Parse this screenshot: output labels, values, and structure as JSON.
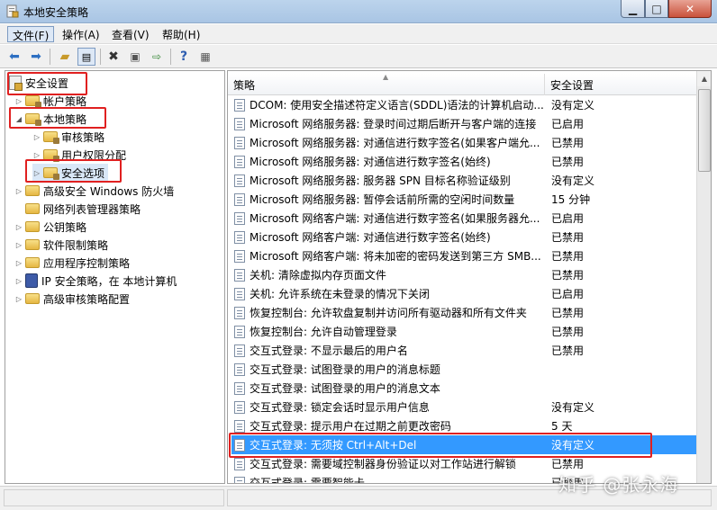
{
  "window": {
    "title": "本地安全策略"
  },
  "menu": {
    "items": [
      "文件(F)",
      "操作(A)",
      "查看(V)",
      "帮助(H)"
    ]
  },
  "tree": {
    "root": "安全设置",
    "items": [
      {
        "label": "帐户策略"
      },
      {
        "label": "本地策略"
      },
      {
        "label": "审核策略"
      },
      {
        "label": "用户权限分配"
      },
      {
        "label": "安全选项"
      },
      {
        "label": "高级安全 Windows 防火墙"
      },
      {
        "label": "网络列表管理器策略"
      },
      {
        "label": "公钥策略"
      },
      {
        "label": "软件限制策略"
      },
      {
        "label": "应用程序控制策略"
      },
      {
        "label": "IP 安全策略，在 本地计算机"
      },
      {
        "label": "高级审核策略配置"
      }
    ]
  },
  "list": {
    "columns": [
      "策略",
      "安全设置"
    ],
    "rows": [
      {
        "name": "DCOM: 使用安全描述符定义语言(SDDL)语法的计算机启动...",
        "value": "没有定义"
      },
      {
        "name": "Microsoft 网络服务器: 登录时间过期后断开与客户端的连接",
        "value": "已启用"
      },
      {
        "name": "Microsoft 网络服务器: 对通信进行数字签名(如果客户端允...",
        "value": "已禁用"
      },
      {
        "name": "Microsoft 网络服务器: 对通信进行数字签名(始终)",
        "value": "已禁用"
      },
      {
        "name": "Microsoft 网络服务器: 服务器 SPN 目标名称验证级别",
        "value": "没有定义"
      },
      {
        "name": "Microsoft 网络服务器: 暂停会话前所需的空闲时间数量",
        "value": "15 分钟"
      },
      {
        "name": "Microsoft 网络客户端: 对通信进行数字签名(如果服务器允...",
        "value": "已启用"
      },
      {
        "name": "Microsoft 网络客户端: 对通信进行数字签名(始终)",
        "value": "已禁用"
      },
      {
        "name": "Microsoft 网络客户端: 将未加密的密码发送到第三方 SMB...",
        "value": "已禁用"
      },
      {
        "name": "关机: 清除虚拟内存页面文件",
        "value": "已禁用"
      },
      {
        "name": "关机: 允许系统在未登录的情况下关闭",
        "value": "已启用"
      },
      {
        "name": "恢复控制台: 允许软盘复制并访问所有驱动器和所有文件夹",
        "value": "已禁用"
      },
      {
        "name": "恢复控制台: 允许自动管理登录",
        "value": "已禁用"
      },
      {
        "name": "交互式登录: 不显示最后的用户名",
        "value": "已禁用"
      },
      {
        "name": "交互式登录: 试图登录的用户的消息标题",
        "value": ""
      },
      {
        "name": "交互式登录: 试图登录的用户的消息文本",
        "value": ""
      },
      {
        "name": "交互式登录: 锁定会话时显示用户信息",
        "value": "没有定义"
      },
      {
        "name": "交互式登录: 提示用户在过期之前更改密码",
        "value": "5 天"
      },
      {
        "name": "交互式登录: 无须按 Ctrl+Alt+Del",
        "value": "没有定义"
      },
      {
        "name": "交互式登录: 需要域控制器身份验证以对工作站进行解锁",
        "value": "已禁用"
      },
      {
        "name": "交互式登录: 需要智能卡",
        "value": "已禁用"
      }
    ]
  },
  "watermark": "知乎 @张永海"
}
